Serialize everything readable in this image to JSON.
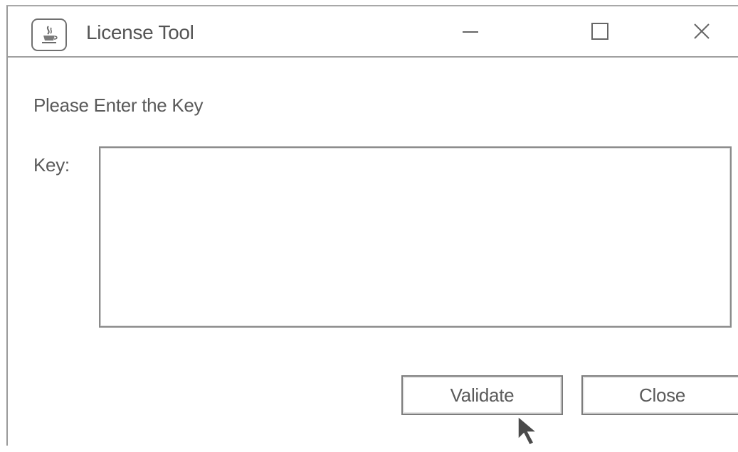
{
  "window": {
    "title": "License Tool",
    "app_icon": "java-cup-icon",
    "controls": {
      "minimize_icon": "minimize-icon",
      "maximize_icon": "maximize-icon",
      "close_icon": "close-icon"
    }
  },
  "form": {
    "heading": "Please Enter the Key",
    "key_label": "Key:",
    "key_value": ""
  },
  "buttons": {
    "validate_label": "Validate",
    "close_label": "Close"
  },
  "pointer": "arrow-cursor-icon"
}
